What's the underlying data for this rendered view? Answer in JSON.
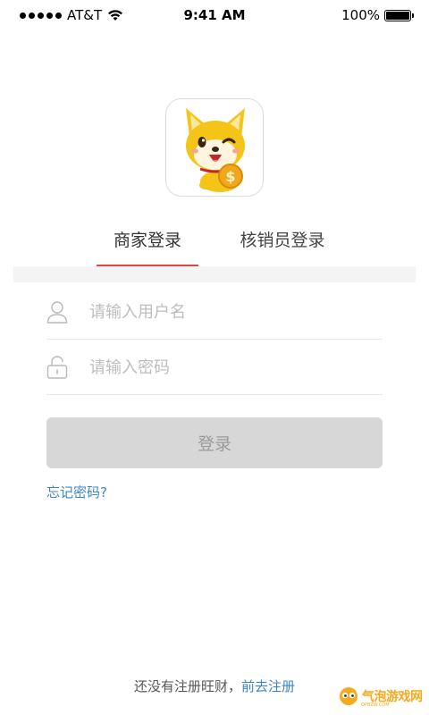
{
  "status_bar": {
    "carrier": "AT&T",
    "time": "9:41 AM",
    "battery": "100%"
  },
  "tabs": [
    {
      "label": "商家登录",
      "active": true
    },
    {
      "label": "核销员登录",
      "active": false
    }
  ],
  "form": {
    "username_placeholder": "请输入用户名",
    "username_value": "",
    "password_placeholder": "请输入密码",
    "password_value": "",
    "login_label": "登录",
    "forgot_label": "忘记密码?"
  },
  "footer": {
    "prompt": "还没有注册旺财，",
    "register_link": "前去注册"
  },
  "watermark": {
    "text": "气泡游戏网",
    "sub": "QPBZW.COM"
  },
  "colors": {
    "accent_red": "#e04848",
    "link_blue": "#3d84c6",
    "button_disabled": "#d7d7d7",
    "watermark_orange": "#f5a91b"
  },
  "icons": {
    "user_field": "user-icon",
    "password_field": "lock-icon",
    "app_logo": "shiba-dog-mascot"
  }
}
